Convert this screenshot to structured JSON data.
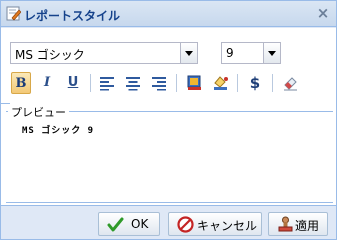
{
  "window": {
    "title": "レポートスタイル",
    "close_label": "×"
  },
  "font": {
    "family_value": "MS ゴシック",
    "size_value": "9"
  },
  "toolbar": {
    "bold_label": "B",
    "italic_label": "I",
    "underline_label": "U",
    "currency_label": "$"
  },
  "preview": {
    "legend": "プレビュー",
    "sample_text": "MS ゴシック 9"
  },
  "footer": {
    "ok_label": "OK",
    "cancel_label": "キャンセル",
    "apply_label": "適用"
  },
  "colors": {
    "title_text": "#15428b",
    "panel_bg": "#dfe8f6",
    "border": "#99bbe8",
    "active_button": "#f3c977"
  }
}
